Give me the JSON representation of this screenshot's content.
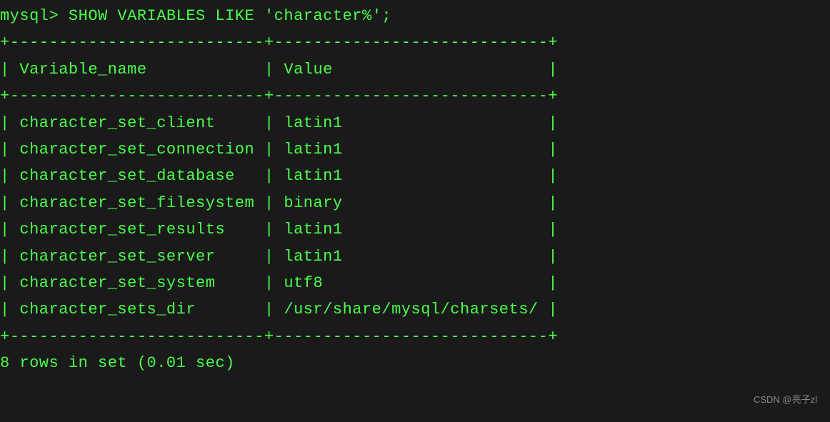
{
  "prompt": "mysql> ",
  "command": "SHOW VARIABLES LIKE 'character%';",
  "divider_top": "+--------------------------+----------------------------+",
  "header_row": "| Variable_name            | Value                      |",
  "divider_mid": "+--------------------------+----------------------------+",
  "rows": [
    "| character_set_client     | latin1                     |",
    "| character_set_connection | latin1                     |",
    "| character_set_database   | latin1                     |",
    "| character_set_filesystem | binary                     |",
    "| character_set_results    | latin1                     |",
    "| character_set_server     | latin1                     |",
    "| character_set_system     | utf8                       |",
    "| character_sets_dir       | /usr/share/mysql/charsets/ |"
  ],
  "divider_bot": "+--------------------------+----------------------------+",
  "footer": "8 rows in set (0.01 sec)",
  "watermark": "CSDN @亮子zl",
  "chart_data": {
    "type": "table",
    "title": "SHOW VARIABLES LIKE 'character%'",
    "columns": [
      "Variable_name",
      "Value"
    ],
    "data": [
      {
        "Variable_name": "character_set_client",
        "Value": "latin1"
      },
      {
        "Variable_name": "character_set_connection",
        "Value": "latin1"
      },
      {
        "Variable_name": "character_set_database",
        "Value": "latin1"
      },
      {
        "Variable_name": "character_set_filesystem",
        "Value": "binary"
      },
      {
        "Variable_name": "character_set_results",
        "Value": "latin1"
      },
      {
        "Variable_name": "character_set_server",
        "Value": "latin1"
      },
      {
        "Variable_name": "character_set_system",
        "Value": "utf8"
      },
      {
        "Variable_name": "character_sets_dir",
        "Value": "/usr/share/mysql/charsets/"
      }
    ],
    "row_count": 8,
    "elapsed_sec": 0.01
  }
}
